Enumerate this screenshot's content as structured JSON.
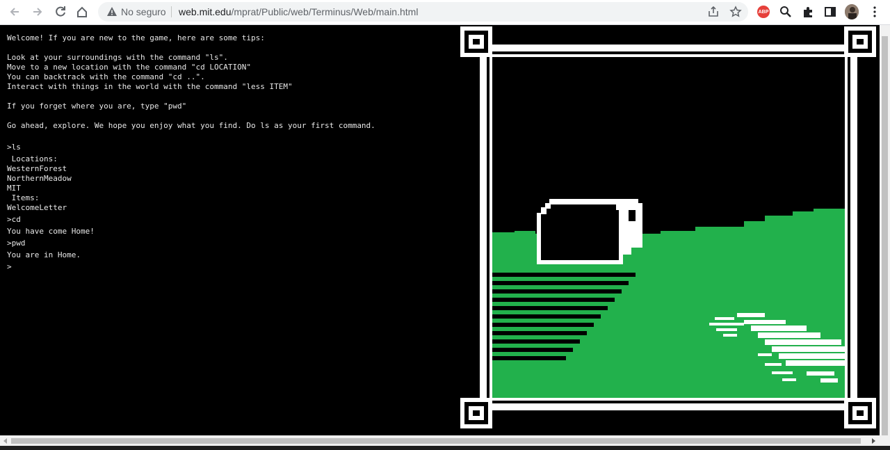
{
  "browser": {
    "security_label": "No seguro",
    "url_host": "web.mit.edu",
    "url_path": "/mprat/Public/web/Terminus/Web/main.html",
    "icons": [
      "back-icon",
      "forward-icon",
      "reload-icon",
      "home-icon",
      "warning-icon",
      "share-icon",
      "star-icon",
      "adblock-icon",
      "search-icon",
      "extensions-icon",
      "sidepanel-icon",
      "avatar",
      "menu-icon"
    ],
    "abp_label": "ABP"
  },
  "terminal": {
    "lines": [
      "Welcome! If you are new to the game, here are some tips:",
      "Look at your surroundings with the command \"ls\".",
      "Move to a new location with the command \"cd LOCATION\"",
      "You can backtrack with the command \"cd ..\".",
      "Interact with things in the world with the command \"less ITEM\"",
      "If you forget where you are, type \"pwd\"",
      "Go ahead, explore. We hope you enjoy what you find. Do ls as your first command.",
      ">ls",
      " Locations:",
      "WesternForest",
      "NorthernMeadow",
      "MIT",
      " Items:",
      "WelcomeLetter",
      ">cd",
      "You have come Home!",
      ">pwd",
      "You are in Home.",
      ">"
    ]
  },
  "colors": {
    "grass": "#22b14c",
    "frame": "#ffffff",
    "background": "#000000"
  }
}
